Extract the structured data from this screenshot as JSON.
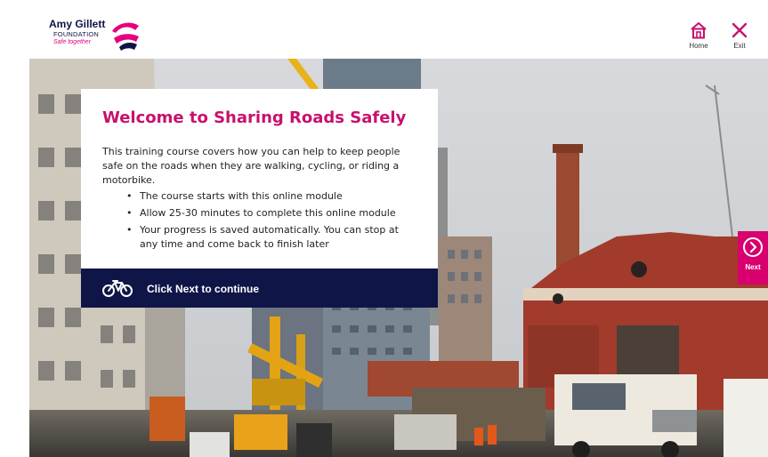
{
  "brand": {
    "name": "Amy Gillett",
    "org": "FOUNDATION",
    "tagline": "Safe together",
    "accent": "#d8006e",
    "navy": "#101548"
  },
  "header": {
    "home_label": "Home",
    "exit_label": "Exit"
  },
  "card": {
    "title": "Welcome to Sharing Roads Safely",
    "intro": "This training course covers how you can help to keep people safe on the roads when they are walking, cycling, or riding a motorbike.",
    "bullets": [
      "The course starts with this online module",
      "Allow 25-30 minutes to complete this online module",
      "Your progress is saved automatically. You can stop at any time and come back to finish later"
    ],
    "cta": "Click Next to continue",
    "cta_icon": "bicycle-icon"
  },
  "next": {
    "label": "Next",
    "icon": "chevron-right-circle-icon"
  },
  "background": {
    "icon": "construction-site-photo"
  }
}
